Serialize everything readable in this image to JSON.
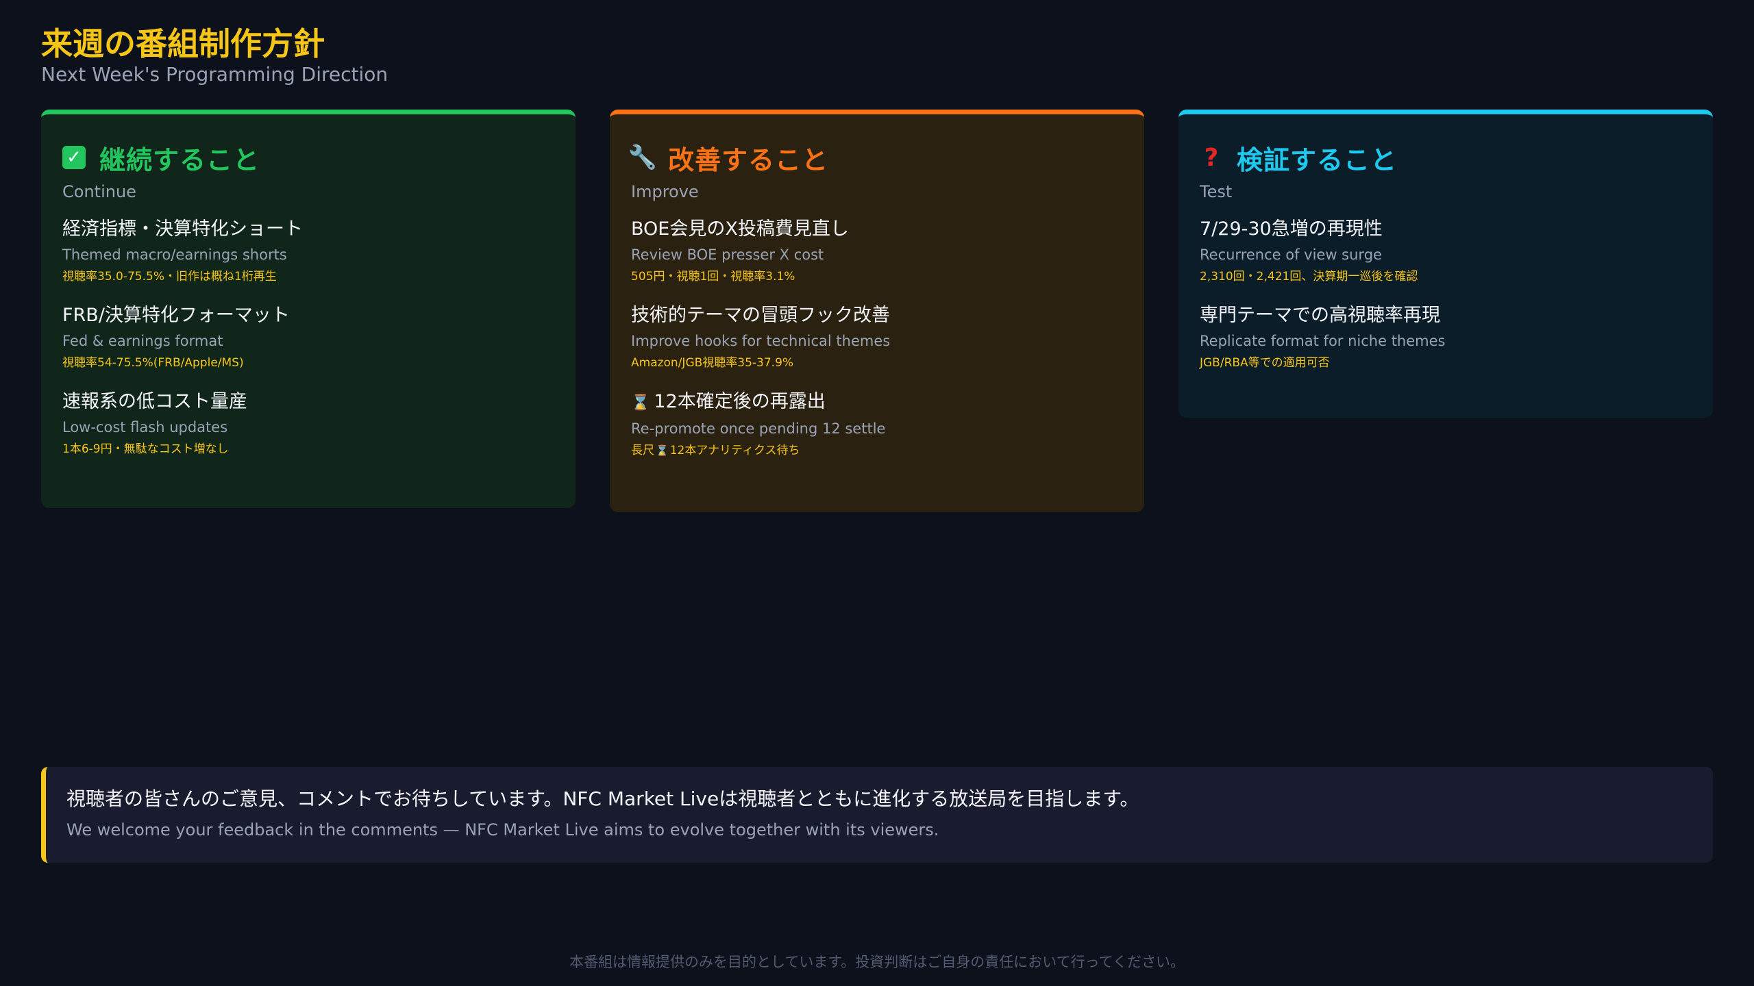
{
  "header": {
    "title_jp": "来週の番組制作方針",
    "title_en": "Next Week's Programming Direction"
  },
  "colors": {
    "accent_yellow": "#f5c518",
    "continue_green": "#22c55e",
    "improve_orange": "#f97316",
    "test_cyan": "#1ec8ef"
  },
  "cards": [
    {
      "icon": "check-icon",
      "title": "継続すること",
      "subtitle": "Continue",
      "items": [
        {
          "jp": "経済指標・決算特化ショート",
          "en": "Themed macro/earnings shorts",
          "note": "視聴率35.0-75.5%・旧作は概ね1桁再生"
        },
        {
          "jp": "FRB/決算特化フォーマット",
          "en": "Fed & earnings format",
          "note": "視聴率54-75.5%(FRB/Apple/MS)"
        },
        {
          "jp": "速報系の低コスト量産",
          "en": "Low-cost flash updates",
          "note": "1本6-9円・無駄なコスト増なし"
        }
      ]
    },
    {
      "icon": "wrench-icon",
      "title": "改善すること",
      "subtitle": "Improve",
      "items": [
        {
          "jp": "BOE会見のX投稿費見直し",
          "en": "Review BOE presser X cost",
          "note": "505円・視聴1回・視聴率3.1%"
        },
        {
          "jp": "技術的テーマの冒頭フック改善",
          "en": "Improve hooks for technical themes",
          "note": "Amazon/JGB視聴率35-37.9%"
        },
        {
          "jp": "12本確定後の再露出",
          "en": "Re-promote once pending 12 settle",
          "note_pre": "長尺",
          "note_post": "12本アナリティクス待ち"
        }
      ]
    },
    {
      "icon": "question-icon",
      "title": "検証すること",
      "subtitle": "Test",
      "items": [
        {
          "jp": "7/29-30急増の再現性",
          "en": "Recurrence of view surge",
          "note": "2,310回・2,421回、決算期一巡後を確認"
        },
        {
          "jp": "専門テーマでの高視聴率再現",
          "en": "Replicate format for niche themes",
          "note": "JGB/RBA等での適用可否"
        }
      ]
    }
  ],
  "feedback": {
    "jp": "視聴者の皆さんのご意見、コメントでお待ちしています。NFC Market Liveは視聴者とともに進化する放送局を目指します。",
    "en": "We welcome your feedback in the comments — NFC Market Live aims to evolve together with its viewers."
  },
  "footer": {
    "disclaimer": "本番組は情報提供のみを目的としています。投資判断はご自身の責任において行ってください。"
  }
}
